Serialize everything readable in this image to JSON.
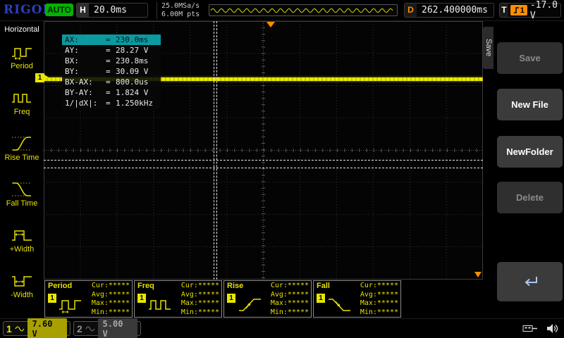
{
  "colors": {
    "accent_yellow": "#e8e000",
    "ch1_yellow": "#e8e800",
    "ch2_gray": "#909090",
    "orange": "#ff8c00",
    "auto_green": "#00b400",
    "cursor_highlight_teal": "#0a9aa0",
    "rigol_blue": "#2c3fc0"
  },
  "top_bar": {
    "logo": "RIGOL",
    "mode": "AUTO",
    "h_label": "H",
    "timebase": "20.0ms",
    "sample_rate": "25.0MSa/s",
    "memory_depth": "6.00M pts",
    "delay_label": "D",
    "delay_value": "262.400000ms",
    "trigger_label": "T",
    "trigger_source": "1",
    "trigger_edge_icon": "rising-edge-icon",
    "trigger_level": "-17.0 V",
    "preview_icon": "waveform-preview"
  },
  "left_sidebar": {
    "title": "Horizontal",
    "items": [
      {
        "label": "Period",
        "icon": "period-icon"
      },
      {
        "label": "Freq",
        "icon": "freq-icon"
      },
      {
        "label": "Rise Time",
        "icon": "rise-time-icon"
      },
      {
        "label": "Fall Time",
        "icon": "fall-time-icon"
      },
      {
        "label": "+Width",
        "icon": "plus-width-icon"
      },
      {
        "label": "-Width",
        "icon": "minus-width-icon"
      }
    ]
  },
  "cursor_readout": {
    "eq": "=",
    "rows": [
      {
        "label": "AX:",
        "value": "230.0ms",
        "highlight": true
      },
      {
        "label": "AY:",
        "value": "28.27 V",
        "highlight": false
      },
      {
        "label": "BX:",
        "value": "230.8ms",
        "highlight": false
      },
      {
        "label": "BY:",
        "value": "30.09 V",
        "highlight": false
      },
      {
        "label": "BX-AX:",
        "value": "800.0us",
        "highlight": false
      },
      {
        "label": "BY-AY:",
        "value": "1.824 V",
        "highlight": false
      },
      {
        "label": "1/|dX|:",
        "value": "1.250kHz",
        "highlight": false
      }
    ]
  },
  "right_menu": {
    "tab": "Save",
    "buttons": [
      {
        "label": "Save",
        "enabled": false
      },
      {
        "label": "New File",
        "enabled": true
      },
      {
        "label": "NewFolder",
        "enabled": true
      },
      {
        "label": "Delete",
        "enabled": false
      },
      {
        "label": "",
        "icon": "return-arrow-icon",
        "enabled": true
      }
    ]
  },
  "measurements": [
    {
      "name": "Period",
      "channel": "1",
      "icon": "period-icon",
      "stats": [
        "Cur:*****",
        "Avg:*****",
        "Max:*****",
        "Min:*****"
      ]
    },
    {
      "name": "Freq",
      "channel": "1",
      "icon": "freq-icon",
      "stats": [
        "Cur:*****",
        "Avg:*****",
        "Max:*****",
        "Min:*****"
      ]
    },
    {
      "name": "Rise",
      "channel": "1",
      "icon": "rise-icon",
      "stats": [
        "Cur:*****",
        "Avg:*****",
        "Max:*****",
        "Min:*****"
      ]
    },
    {
      "name": "Fall",
      "channel": "1",
      "icon": "fall-icon",
      "stats": [
        "Cur:*****",
        "Avg:*****",
        "Max:*****",
        "Min:*****"
      ]
    }
  ],
  "graticule": {
    "ch1_marker": "1",
    "trigger_position_marker": "orange-triangle",
    "trigger_level_marker": "orange-triangle"
  },
  "bottom_bar": {
    "channels": [
      {
        "number": "1",
        "value": "7.60 V",
        "coupling_icon": "ac-wave-icon",
        "active": true
      },
      {
        "number": "2",
        "value": "5.00 V",
        "coupling_icon": "ac-wave-icon",
        "active": false
      }
    ],
    "icons": [
      "usb-icon",
      "speaker-icon"
    ]
  }
}
